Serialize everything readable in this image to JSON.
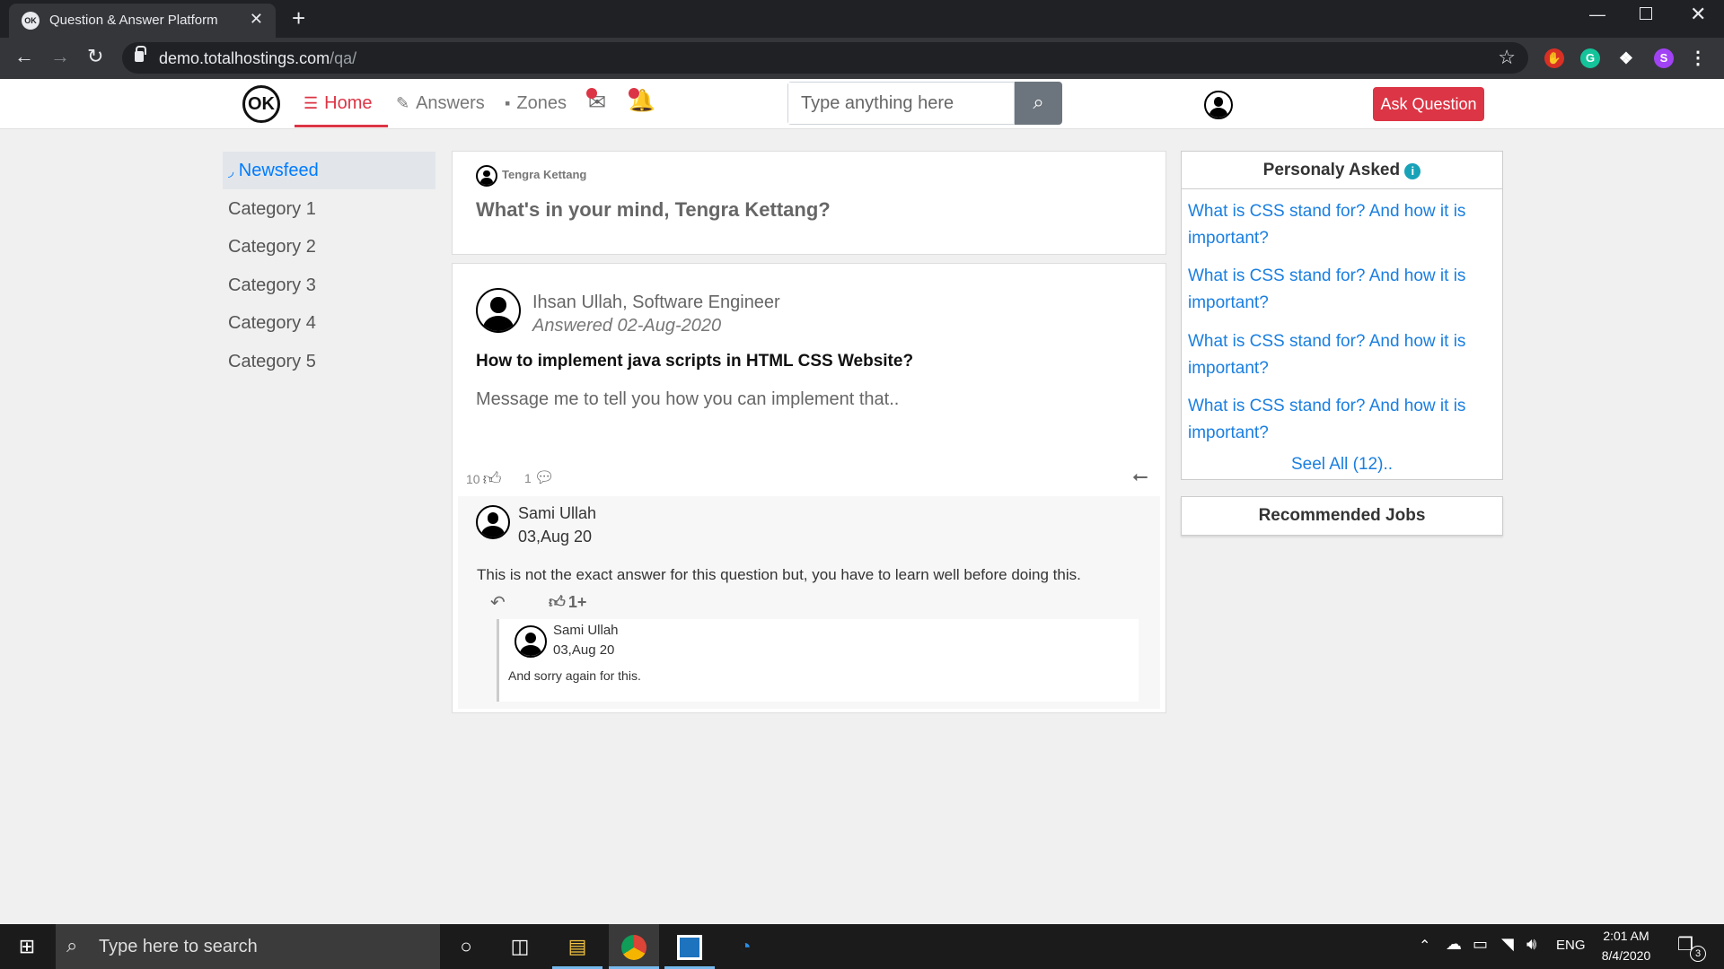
{
  "browser": {
    "tab_title": "Question & Answer Platform",
    "tab_icon_text": "OK",
    "tab_close": "✕",
    "new_tab": "+",
    "url_host": "demo.totalhostings.com",
    "url_path": "/qa/",
    "profile_initial": "S"
  },
  "site": {
    "logo_text": "OK",
    "nav": [
      {
        "label": "Home",
        "icon": "list-icon",
        "active": true
      },
      {
        "label": "Answers",
        "icon": "edit-icon"
      },
      {
        "label": "Zones",
        "icon": "zone-icon"
      }
    ],
    "search_placeholder": "Type anything here",
    "ask_button": "Ask Question"
  },
  "sidebar": {
    "items": [
      {
        "label": "Newsfeed",
        "icon": "rss-icon",
        "active": true
      },
      {
        "label": "Category 1"
      },
      {
        "label": "Category 2"
      },
      {
        "label": "Category 3"
      },
      {
        "label": "Category 4"
      },
      {
        "label": "Category 5"
      }
    ]
  },
  "composer": {
    "user": "Tengra Kettang",
    "prompt": "What's in your mind, Tengra Kettang?"
  },
  "post": {
    "author": "Ihsan Ullah",
    "role": ", Software Engineer",
    "answered": "Answered 02-Aug-2020",
    "question": "How to implement java scripts in HTML CSS Website?",
    "answer": "Message me to tell you how you can implement that..",
    "likes": "10",
    "comments": "1",
    "comment": {
      "author": "Sami Ullah",
      "date": "03,Aug 20",
      "text": "This is not the exact answer for this question but, you have to learn well before doing this.",
      "likes": "1+",
      "reply": {
        "author": "Sami Ullah",
        "date": "03,Aug 20",
        "text": "And sorry again for this."
      }
    }
  },
  "personally_asked": {
    "title": "Personaly Asked",
    "items": [
      "What is CSS stand for? And how it is important?",
      "What is CSS stand for? And how it is important?",
      "What is CSS stand for? And how it is important?",
      "What is CSS stand for? And how it is important?"
    ],
    "see_all": "Seel All (12).."
  },
  "recommended_jobs": {
    "title": "Recommended Jobs"
  },
  "taskbar": {
    "search_placeholder": "Type here to search",
    "language": "ENG",
    "time": "2:01 AM",
    "date": "8/4/2020",
    "notification_count": "3"
  },
  "colors": {
    "accent": "#dc3545",
    "link": "#1a7fe0",
    "active_sidebar": "#007bff"
  }
}
